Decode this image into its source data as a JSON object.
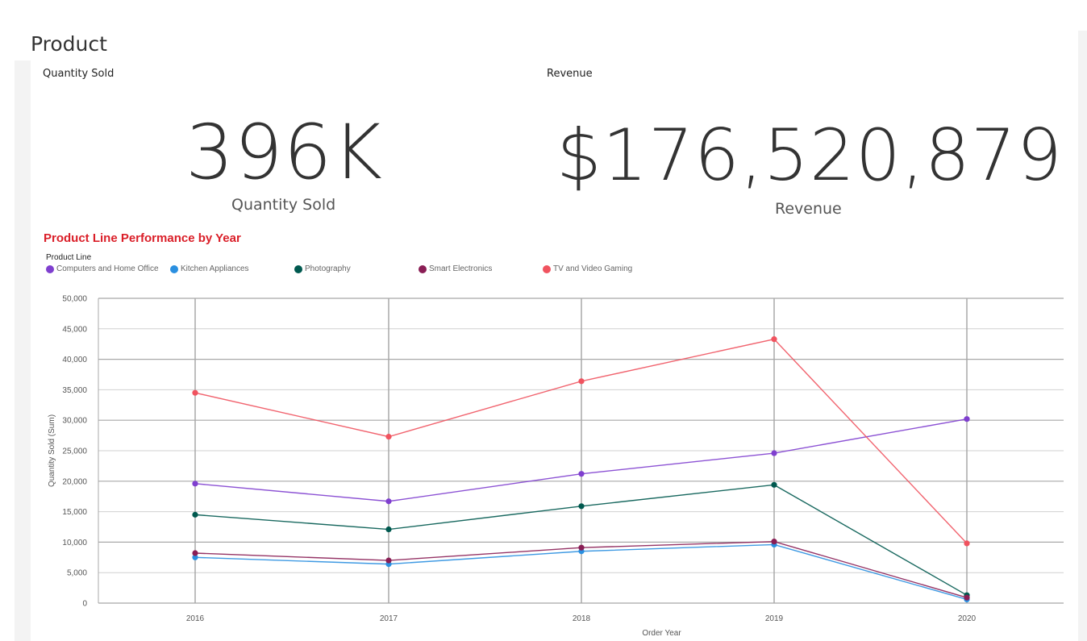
{
  "page": {
    "title": "Product"
  },
  "kpis": {
    "quantity": {
      "label": "Quantity Sold",
      "value": "396K",
      "caption": "Quantity Sold"
    },
    "revenue": {
      "label": "Revenue",
      "value": "$176,520,879",
      "caption": "Revenue"
    }
  },
  "chart": {
    "title": "Product Line Performance by Year",
    "legend_title": "Product Line"
  },
  "chart_data": {
    "type": "line",
    "title": "Product Line Performance by Year",
    "xlabel": "Order Year",
    "ylabel": "Quantity Sold (Sum)",
    "ylim": [
      0,
      50000
    ],
    "yticks": [
      0,
      5000,
      10000,
      15000,
      20000,
      25000,
      30000,
      35000,
      40000,
      45000,
      50000
    ],
    "ytick_labels": [
      "0",
      "5,000",
      "10,000",
      "15,000",
      "20,000",
      "25,000",
      "30,000",
      "35,000",
      "40,000",
      "45,000",
      "50,000"
    ],
    "categories": [
      "2016",
      "2017",
      "2018",
      "2019",
      "2020"
    ],
    "grid": true,
    "legend_position": "top-left",
    "series": [
      {
        "name": "Computers and Home Office",
        "color": "#7f3fcf",
        "values": [
          19600,
          16700,
          21200,
          24600,
          30200
        ]
      },
      {
        "name": "Kitchen Appliances",
        "color": "#2a8fe0",
        "values": [
          7500,
          6400,
          8500,
          9600,
          600
        ]
      },
      {
        "name": "Photography",
        "color": "#00594f",
        "values": [
          14500,
          12100,
          15900,
          19400,
          1300
        ]
      },
      {
        "name": "Smart Electronics",
        "color": "#8a1e55",
        "values": [
          8200,
          7000,
          9100,
          10100,
          900
        ]
      },
      {
        "name": "TV and Video Gaming",
        "color": "#f0535f",
        "values": [
          34500,
          27300,
          36400,
          43300,
          9800
        ]
      }
    ]
  }
}
